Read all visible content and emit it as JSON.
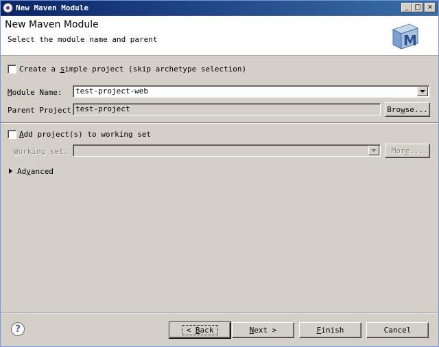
{
  "window": {
    "title": "New Maven Module"
  },
  "header": {
    "title": "New Maven Module",
    "subtitle": "Select the module name and parent",
    "logo_letter": "M"
  },
  "form": {
    "simple_project": {
      "label_pre": "Create a ",
      "label_mnemonic": "s",
      "label_post": "imple project (skip archetype selection)",
      "checked": false
    },
    "module_name": {
      "label_mnemonic": "M",
      "label_rest": "odule Name:",
      "value": "test-project-web"
    },
    "parent_project": {
      "label": "Parent Project:",
      "value": "test-project",
      "browse_mnemonic": "w",
      "browse_pre": "Bro",
      "browse_post": "se..."
    },
    "working_set_check": {
      "label_mnemonic": "A",
      "label_rest": "dd project(s) to working set",
      "checked": false
    },
    "working_set": {
      "label_mnemonic": "W",
      "label_rest": "orking set:",
      "value": "",
      "more_pre": "Mor",
      "more_mnemonic": "e",
      "more_post": "..."
    },
    "advanced": {
      "label_pre": "Ad",
      "label_mnemonic": "v",
      "label_post": "anced"
    }
  },
  "buttons": {
    "back": {
      "pre": "< ",
      "mnemonic": "B",
      "post": "ack"
    },
    "next": {
      "mnemonic": "N",
      "post": "ext >"
    },
    "finish": {
      "mnemonic": "F",
      "post": "inish"
    },
    "cancel": {
      "label": "Cancel"
    }
  },
  "icons": {
    "help": "help-icon",
    "app": "maven-app-icon"
  }
}
